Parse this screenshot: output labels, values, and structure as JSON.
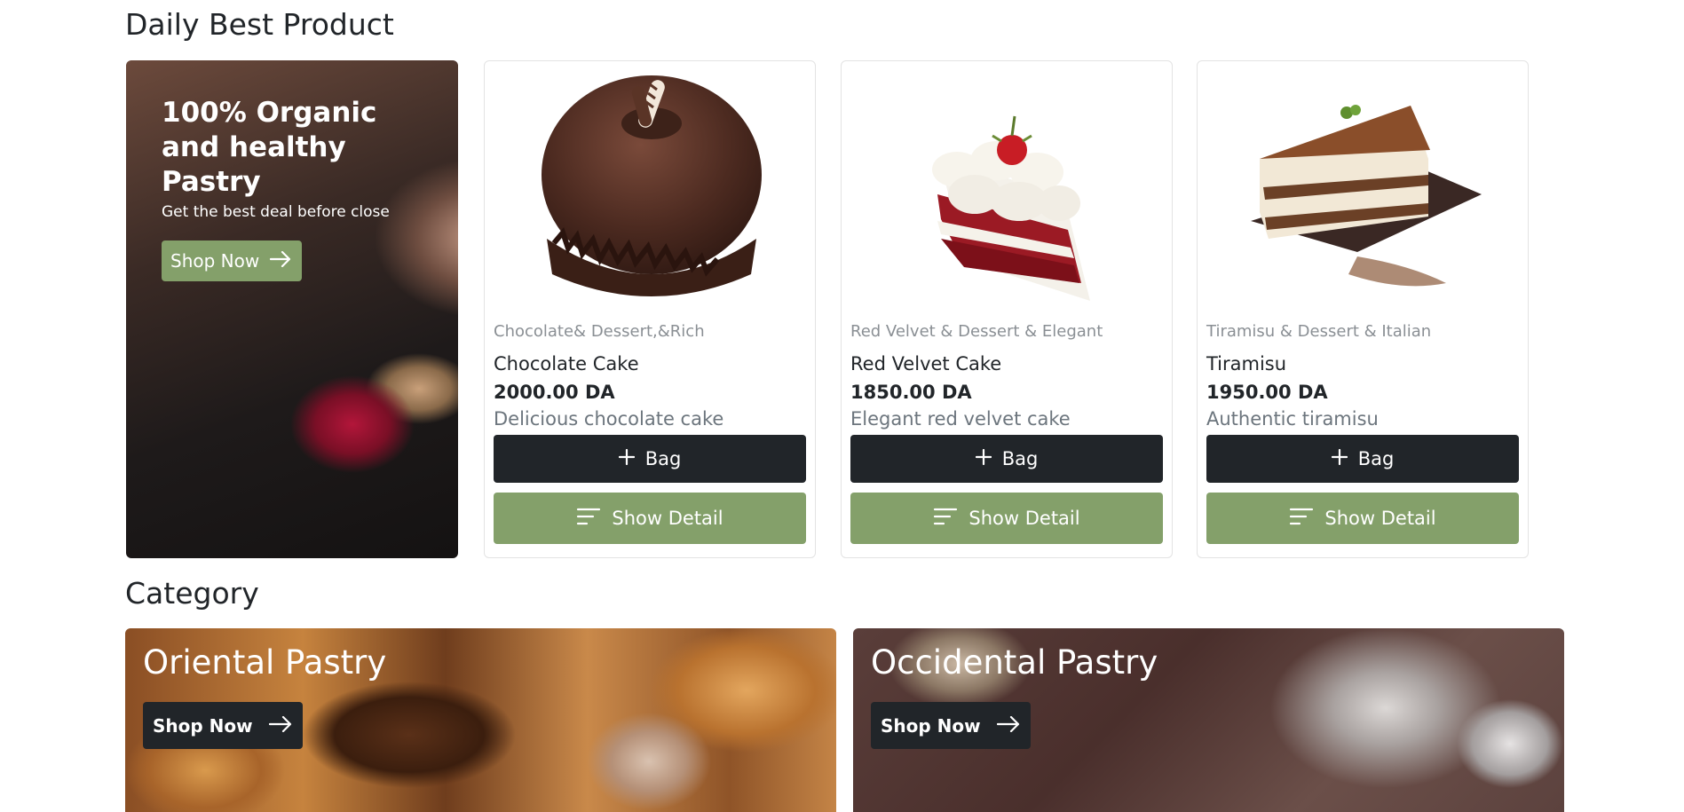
{
  "sections": {
    "daily_title": "Daily Best Product",
    "category_title": "Category"
  },
  "promo": {
    "heading": "100% Organic and healthy Pastry",
    "subtitle": "Get the best deal before close",
    "button_label": "Shop Now",
    "button_icon": "arrow-right-icon"
  },
  "products": [
    {
      "category": "Chocolate& Dessert,&Rich",
      "name": "Chocolate Cake",
      "price": "2000.00 DA",
      "description": "Delicious chocolate cake",
      "bag_label": "Bag",
      "detail_label": "Show Detail"
    },
    {
      "category": "Red Velvet & Dessert & Elegant",
      "name": "Red Velvet Cake",
      "price": "1850.00 DA",
      "description": "Elegant red velvet cake",
      "bag_label": "Bag",
      "detail_label": "Show Detail"
    },
    {
      "category": "Tiramisu & Dessert & Italian",
      "name": "Tiramisu",
      "price": "1950.00 DA",
      "description": "Authentic tiramisu",
      "bag_label": "Bag",
      "detail_label": "Show Detail"
    }
  ],
  "categories": [
    {
      "title": "Oriental Pastry",
      "button_label": "Shop Now"
    },
    {
      "title": "Occidental Pastry",
      "button_label": "Shop Now"
    }
  ],
  "colors": {
    "accent_green": "#84a06a",
    "dark_button": "#212529",
    "muted_text": "#6c757d"
  }
}
